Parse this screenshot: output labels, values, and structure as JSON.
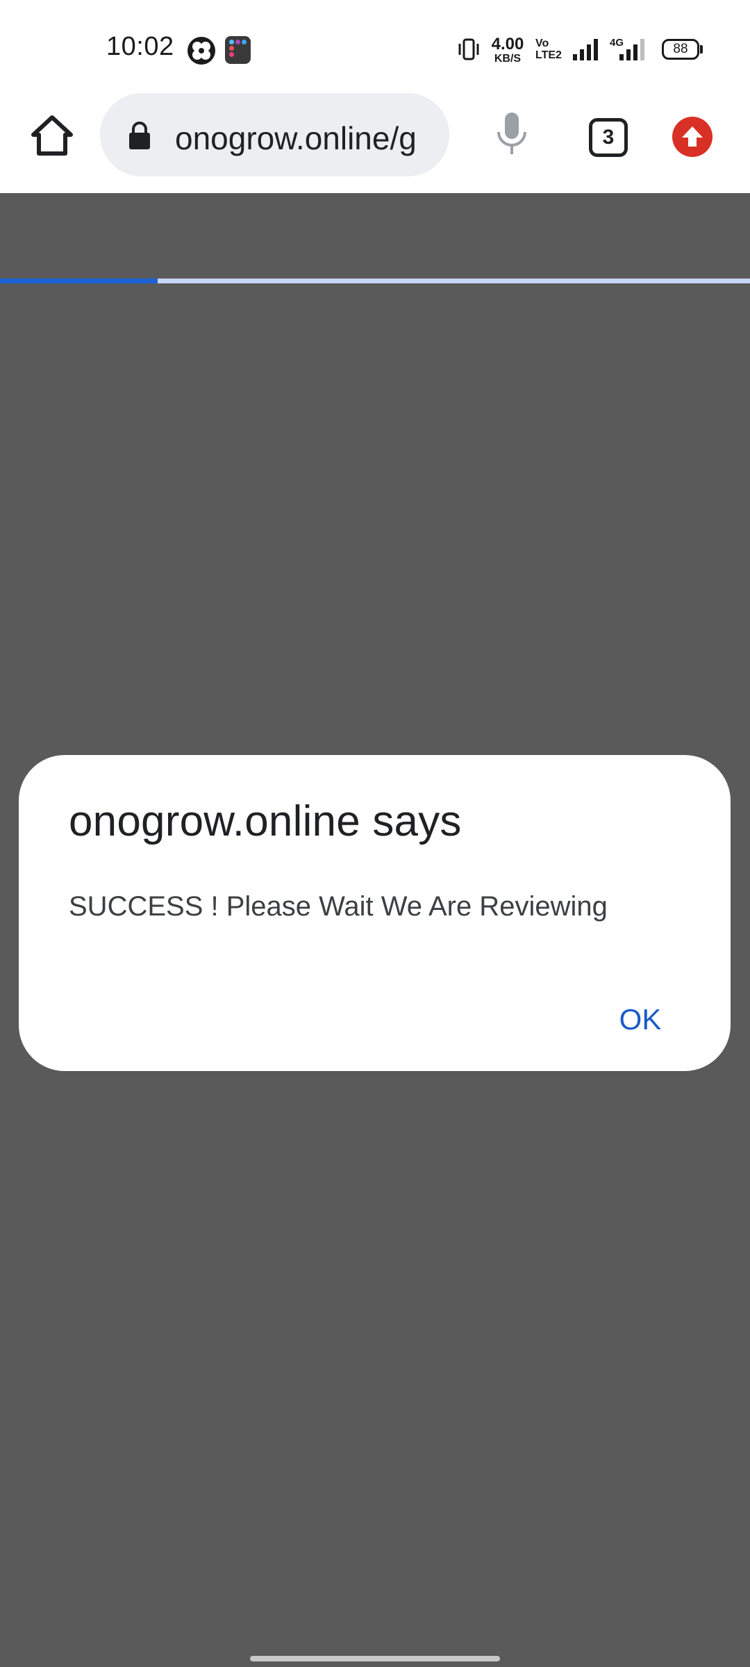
{
  "status_bar": {
    "time": "10:02",
    "net_speed_value": "4.00",
    "net_speed_unit": "KB/S",
    "volte_top": "Vo",
    "volte_bottom": "LTE2",
    "network_type": "4G",
    "battery_level": "88",
    "icons": [
      "app-notification-icon",
      "app-notification-icon",
      "vibrate-icon",
      "signal-icon",
      "signal-icon",
      "battery-icon"
    ]
  },
  "browser": {
    "url": "onogrow.online/g",
    "tab_count": "3",
    "page_load_progress": 0.21,
    "colors": {
      "progress": "#1a62d6",
      "update_badge": "#d93025",
      "omnibox_bg": "#eceef1"
    }
  },
  "dialog": {
    "title": "onogrow.online says",
    "message": "SUCCESS ! Please Wait We Are Reviewing",
    "ok_label": "OK",
    "accent_color": "#1a5ac6"
  }
}
